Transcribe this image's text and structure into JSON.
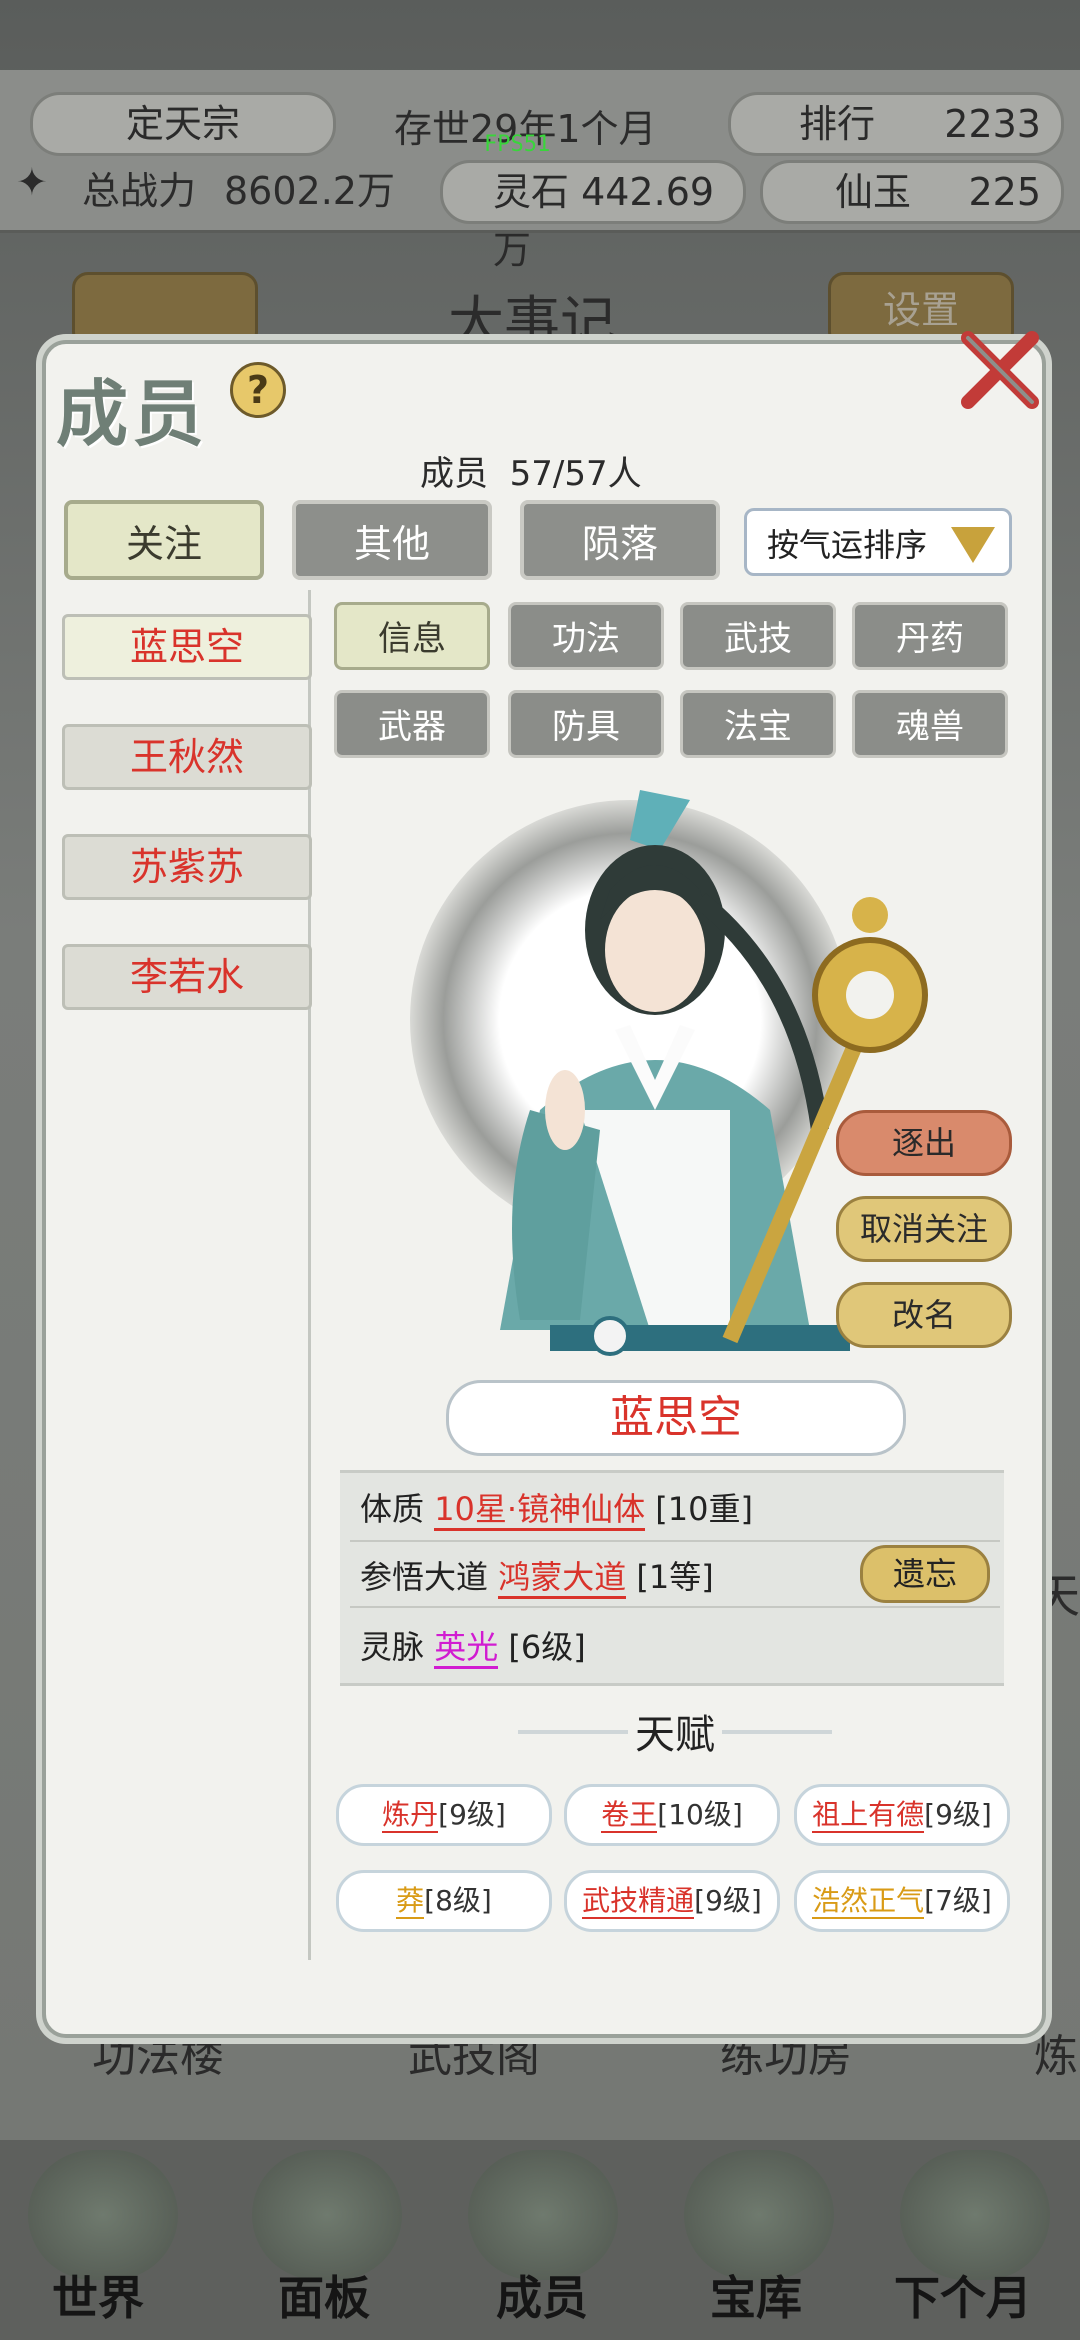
{
  "topbar": {
    "sect_name": "定天宗",
    "era": "存世29年1个月",
    "rank_label": "排行",
    "rank_value": "2233",
    "power_label": "总战力",
    "power_value": "8602.2万",
    "fps": "FPS51",
    "spirit_stone": "灵石 442.69万",
    "jade_label": "仙玉",
    "jade_value": "225"
  },
  "background": {
    "chronicle": "大事记",
    "settings": "设置",
    "buildings": [
      "功法楼",
      "武技阁",
      "练功房",
      "炼"
    ],
    "side_char": "天"
  },
  "nav": {
    "items": [
      "世界",
      "面板",
      "成员",
      "宝库",
      "下个月"
    ]
  },
  "dialog": {
    "title": "成员",
    "help": "?",
    "count_label": "成员",
    "count_value": "57/57人",
    "tabs": [
      "关注",
      "其他",
      "陨落"
    ],
    "sort_label": "按气运排序",
    "members": [
      "蓝思空",
      "王秋然",
      "苏紫苏",
      "李若水"
    ],
    "subtabs": [
      "信息",
      "功法",
      "武技",
      "丹药",
      "武器",
      "防具",
      "法宝",
      "魂兽"
    ],
    "actions": [
      "逐出",
      "取消关注",
      "改名"
    ],
    "selected_name": "蓝思空",
    "info": {
      "physique_label": "体质",
      "physique_value": "10星·镜神仙体",
      "physique_level": "[10重]",
      "dao_label": "参悟大道",
      "dao_value": "鸿蒙大道",
      "dao_level": "[1等]",
      "forget_button": "遗忘",
      "vein_label": "灵脉",
      "vein_value": "英光",
      "vein_level": "[6级]"
    },
    "talent_title": "天赋",
    "talents": [
      {
        "name": "炼丹",
        "level": "[9级]"
      },
      {
        "name": "卷王",
        "level": "[10级]"
      },
      {
        "name": "祖上有德",
        "level": "[9级]"
      },
      {
        "name": "莽",
        "level": "[8级]"
      },
      {
        "name": "武技精通",
        "level": "[9级]"
      },
      {
        "name": "浩然正气",
        "level": "[7级]"
      }
    ]
  }
}
